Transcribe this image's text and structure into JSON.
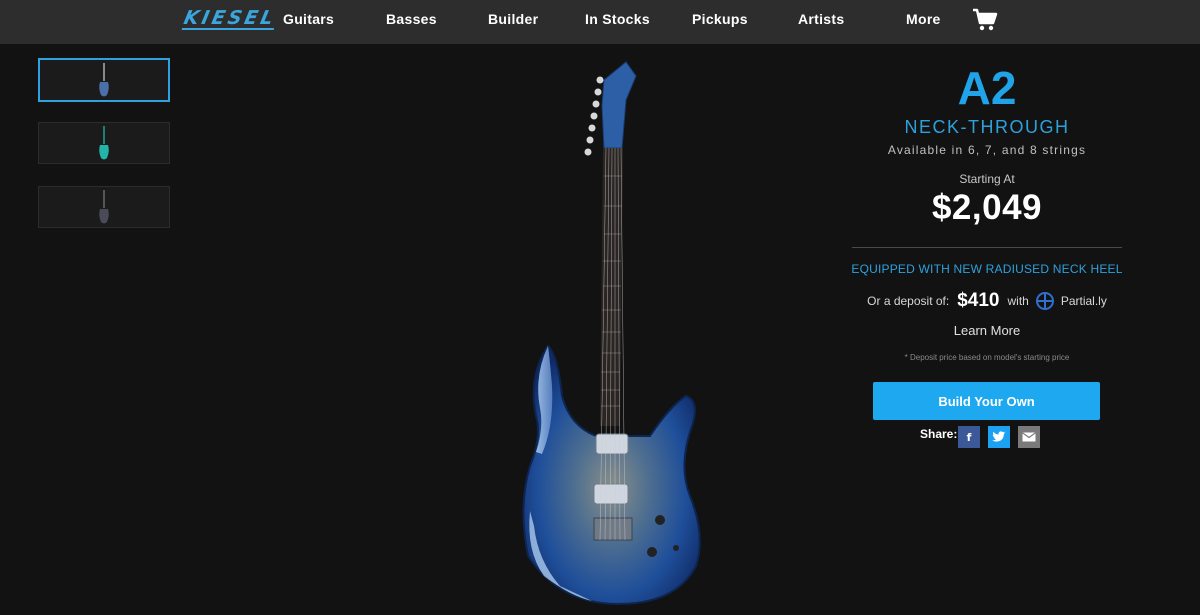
{
  "nav": {
    "logo": "KIESEL",
    "items": [
      "Guitars",
      "Basses",
      "Builder",
      "In Stocks",
      "Pickups",
      "Artists",
      "More"
    ],
    "cart_icon": "cart-icon"
  },
  "thumbnails": [
    {
      "name": "thumb-1",
      "active": true,
      "color": "#4b6fa8"
    },
    {
      "name": "thumb-2",
      "active": false,
      "color": "#23b3a8"
    },
    {
      "name": "thumb-3",
      "active": false,
      "color": "#4a4a58"
    }
  ],
  "product": {
    "model": "A2",
    "variant": "NECK-THROUGH",
    "availability": "Available in 6, 7, and 8 strings",
    "starting_label": "Starting At",
    "price": "$2,049",
    "feature": "EQUIPPED WITH NEW RADIUSED NECK HEEL",
    "deposit_prefix": "Or a deposit of:",
    "deposit_amount": "$410",
    "deposit_with": "with",
    "partner": "Partial.ly",
    "learn_more": "Learn More",
    "disclaimer": "* Deposit price based on model's starting price",
    "build_button": "Build Your Own",
    "share_label": "Share:",
    "share_icons": [
      "facebook-icon",
      "twitter-icon",
      "mail-icon"
    ]
  },
  "colors": {
    "accent": "#20a3e8",
    "button": "#1ea8f0",
    "nav_bg": "#2d2d2d",
    "page_bg": "#121212",
    "facebook": "#3b5998",
    "twitter": "#1da1f2",
    "mail": "#7a7a7a"
  }
}
